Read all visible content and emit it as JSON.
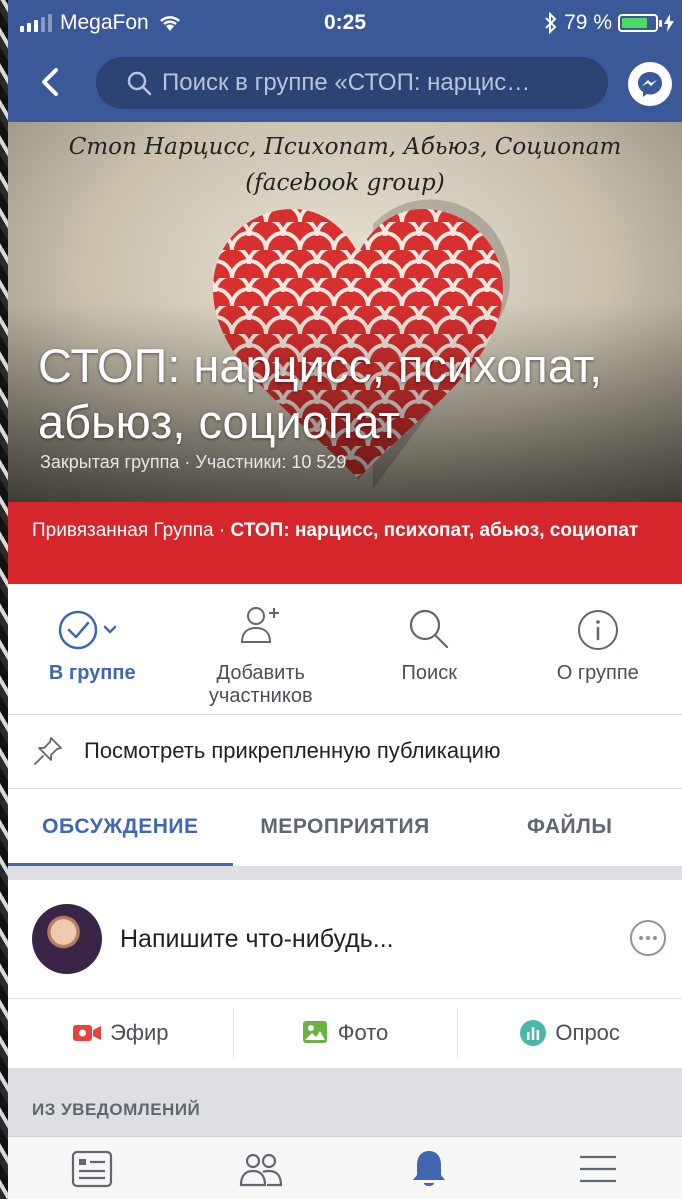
{
  "status_bar": {
    "carrier": "MegaFon",
    "time": "0:25",
    "battery": "79 %",
    "battery_level": 0.79
  },
  "header": {
    "search_placeholder": "Поиск в группе «СТОП: нарцис…",
    "icons": [
      "back-arrow-icon",
      "search-icon",
      "messenger-icon"
    ],
    "colors": {
      "bar": "#3b5998"
    }
  },
  "cover": {
    "caption_line1": "Стоп Нарцисс, Психопат, Абьюз, Социопат",
    "caption_line2": "(facebook group)",
    "group_name": "СТОП: нарцисс, психопат, абьюз, социопат",
    "meta": "Закрытая группа · Участники: 10 529"
  },
  "linked_group": {
    "prefix": "Привязанная Группа · ",
    "name": "СТОП: нарцисс, психопат, абьюз, социопат",
    "color": "#d5262b"
  },
  "actions": [
    {
      "label": "В группе",
      "icon": "check-circle-icon"
    },
    {
      "label": "Добавить участников",
      "icon": "add-person-icon"
    },
    {
      "label": "Поиск",
      "icon": "search-icon"
    },
    {
      "label": "О группе",
      "icon": "info-icon"
    }
  ],
  "pinned": {
    "label": "Посмотреть прикрепленную публикацию",
    "icon": "pin-icon"
  },
  "tabs": [
    {
      "label": "ОБСУЖДЕНИЕ",
      "active": true
    },
    {
      "label": "МЕРОПРИЯТИЯ",
      "active": false
    },
    {
      "label": "ФАЙЛЫ",
      "active": false
    }
  ],
  "composer": {
    "placeholder": "Напишите что-нибудь...",
    "post_actions": [
      {
        "label": "Эфир",
        "icon": "live-video-icon",
        "color": "#e9423d"
      },
      {
        "label": "Фото",
        "icon": "photo-icon",
        "color": "#6bb244"
      },
      {
        "label": "Опрос",
        "icon": "poll-icon",
        "color": "#4ab7a8"
      }
    ]
  },
  "section_header": "ИЗ УВЕДОМЛЕНИЙ",
  "tabbar": {
    "items": [
      "news-feed-icon",
      "friends-icon",
      "notifications-icon",
      "menu-icon"
    ],
    "active_index": 2,
    "active_color": "#4267b2"
  }
}
